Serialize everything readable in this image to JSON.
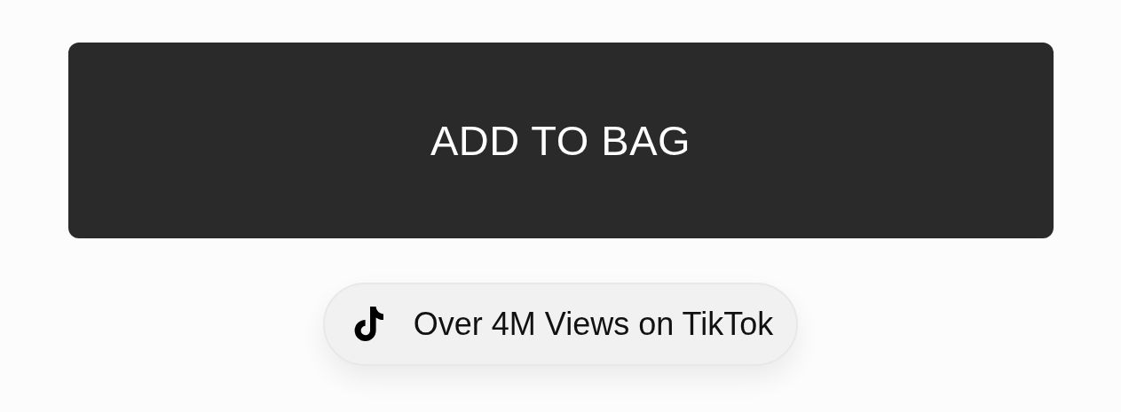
{
  "button": {
    "label": "ADD TO BAG"
  },
  "badge": {
    "text": "Over 4M Views on TikTok"
  }
}
